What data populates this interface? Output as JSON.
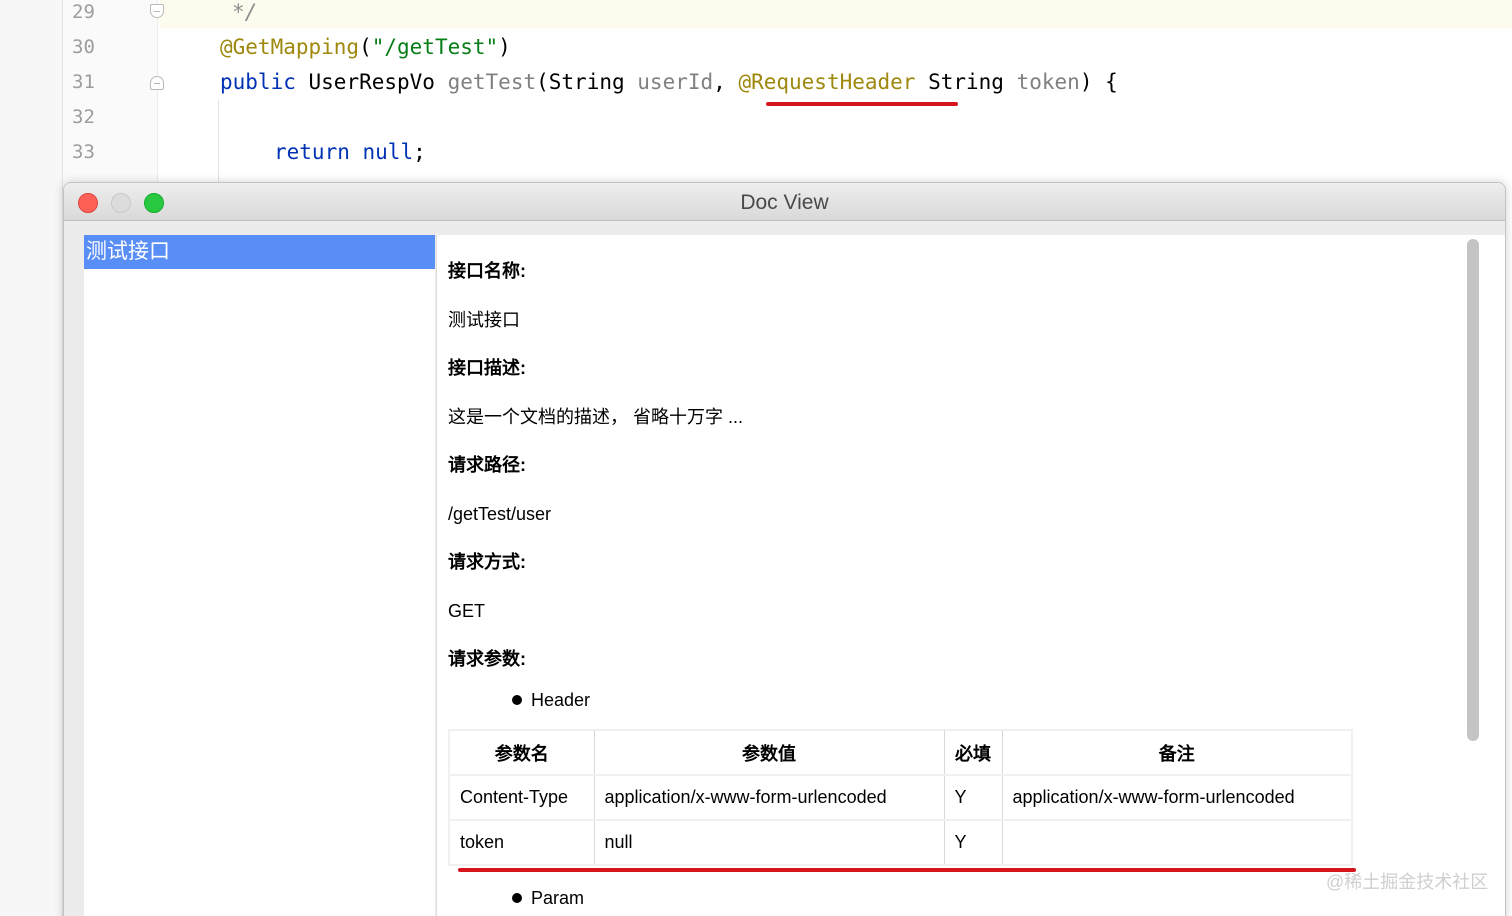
{
  "editor": {
    "lines": [
      {
        "num": "29",
        "comment": "*/"
      },
      {
        "num": "30",
        "annotation": "@GetMapping",
        "paren_open": "(",
        "string": "\"/getTest\"",
        "paren_close": ")"
      },
      {
        "num": "31",
        "kw_public": "public",
        "type": "UserRespVo",
        "method": "getTest",
        "p1": "(String ",
        "userid": "userId",
        "comma": ", ",
        "annotation": "@RequestHeader",
        "p2": " String ",
        "token": "token",
        "p3": ") {"
      },
      {
        "num": "32"
      },
      {
        "num": "33",
        "kw_return": "return",
        "kw_null": "null",
        "semi": ";"
      }
    ]
  },
  "window": {
    "title": "Doc View"
  },
  "nav": {
    "items": [
      "测试接口"
    ]
  },
  "doc": {
    "name_label": "接口名称:",
    "name_value": "测试接口",
    "desc_label": "接口描述:",
    "desc_value": "这是一个文档的描述， 省略十万字 ...",
    "path_label": "请求路径:",
    "path_value": "/getTest/user",
    "method_label": "请求方式:",
    "method_value": "GET",
    "params_label": "请求参数:",
    "header_bullet": "Header",
    "param_bullet": "Param",
    "table": {
      "headers": [
        "参数名",
        "参数值",
        "必填",
        "备注"
      ],
      "rows": [
        [
          "Content-Type",
          "application/x-www-form-urlencoded",
          "Y",
          "application/x-www-form-urlencoded"
        ],
        [
          "token",
          "null",
          "Y",
          ""
        ]
      ]
    }
  },
  "watermark": "@稀土掘金技术社区",
  "colors": {
    "selection": "#5a8ef7",
    "underline": "#d6141c",
    "keyword": "#0033b3",
    "annotation": "#9e880d",
    "string": "#067d17"
  }
}
